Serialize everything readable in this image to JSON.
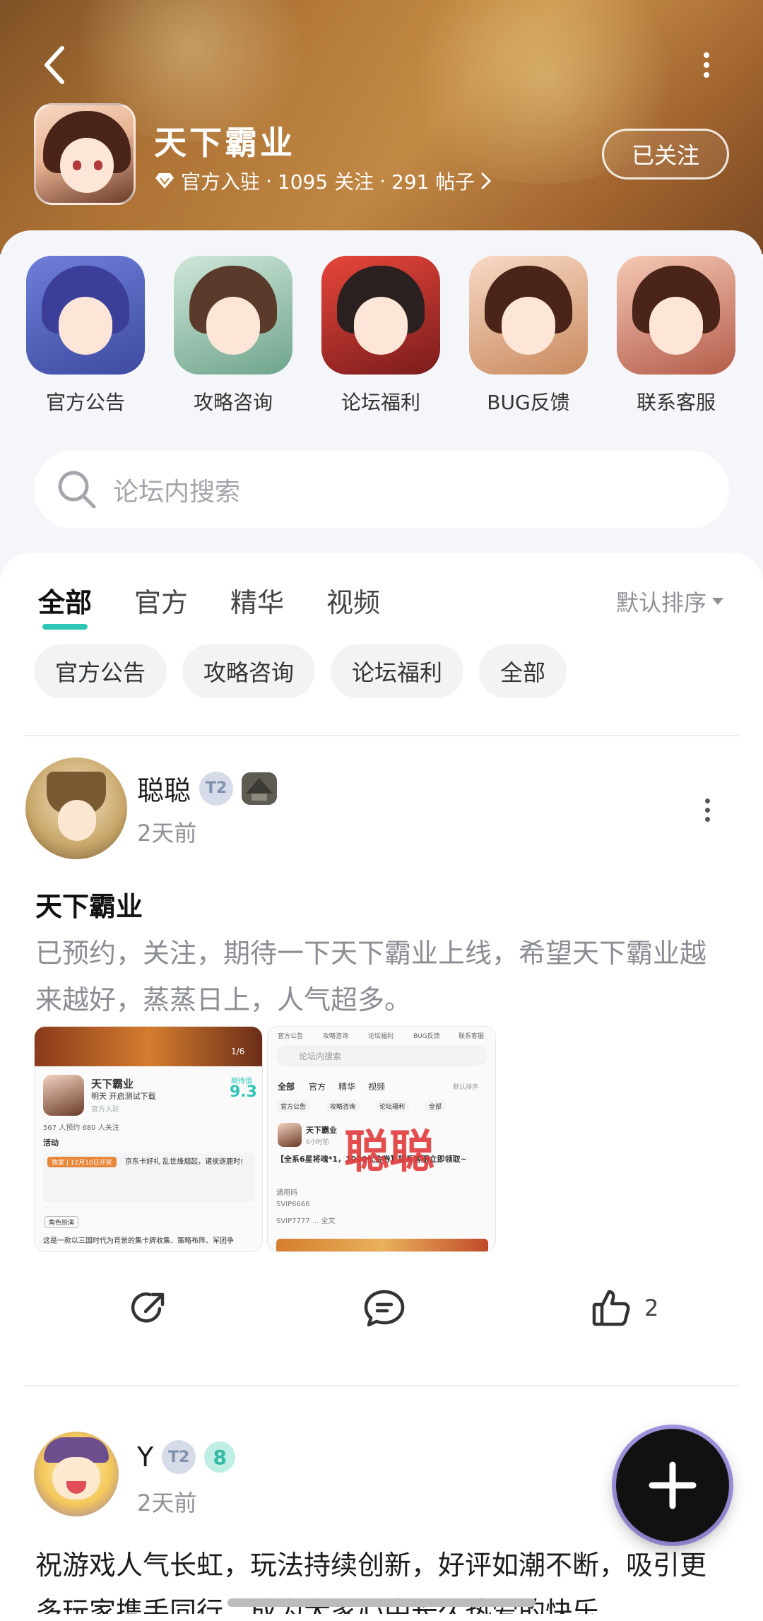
{
  "header": {
    "game_title": "天下霸业",
    "official_label": "官方入驻",
    "followers": "1095 关注",
    "posts": "291 帖子",
    "separator": "·",
    "follow_label": "已关注"
  },
  "shortcuts": [
    {
      "label": "官方公告"
    },
    {
      "label": "攻略咨询"
    },
    {
      "label": "论坛福利"
    },
    {
      "label": "BUG反馈"
    },
    {
      "label": "联系客服"
    }
  ],
  "search": {
    "placeholder": "论坛内搜索"
  },
  "tabs": [
    {
      "label": "全部",
      "active": true
    },
    {
      "label": "官方"
    },
    {
      "label": "精华"
    },
    {
      "label": "视频"
    }
  ],
  "sort_label": "默认排序",
  "chips": [
    {
      "label": "官方公告"
    },
    {
      "label": "攻略咨询"
    },
    {
      "label": "论坛福利"
    },
    {
      "label": "全部"
    }
  ],
  "posts": [
    {
      "author": "聪聪",
      "level": "T2",
      "time": "2天前",
      "title": "天下霸业",
      "body": "已预约，关注，期待一下天下霸业上线，希望天下霸业越来越好，蒸蒸日上，人气超多。",
      "likes": "2",
      "thumb1": {
        "title": "天下霸业",
        "subtitle": "明天 开启测试下载",
        "official": "官方入驻",
        "stats": "567 人预约   680 人关注",
        "rating_label": "期待值",
        "rating": "9.3",
        "page": "1/6",
        "activity": "活动",
        "event_tag": "独家 | 12月10日开奖",
        "event_text": "京东卡好礼 乱世烽烟起，诸侯逐鹿时!",
        "role_tag": "角色扮演",
        "desc": "这是一款以三国时代为背景的集卡牌收集、策略布阵、军团争"
      },
      "thumb2": {
        "tabs": [
          "官方公告",
          "攻略咨询",
          "论坛福利",
          "BUG反馈",
          "联系客服"
        ],
        "search": "论坛内搜索",
        "feed_tabs": [
          "全部",
          "官方",
          "精华",
          "视频"
        ],
        "sort": "默认排序",
        "chips": [
          "官方公告",
          "攻略咨询",
          "论坛福利",
          "全部"
        ],
        "post_author": "天下霸业",
        "post_time": "6小时前",
        "post_title": "【全系6星将魂*1，1000代金券】联系客服立即领取~",
        "lines": [
          "通用码",
          "SVIP6666",
          "SVIP7777 ... 全文"
        ],
        "watermark": "聪聪"
      }
    },
    {
      "author": "Y",
      "level": "T2",
      "badge": "8",
      "time": "2天前",
      "body": "祝游戏人气长虹，玩法持续创新，好评如潮不断，吸引更多玩家携手同行，成为大家心中长久热爱的快乐"
    }
  ],
  "colors": {
    "accent": "#2fc6b8",
    "banner": "#c7873f",
    "watermark": "#e23b3b"
  }
}
